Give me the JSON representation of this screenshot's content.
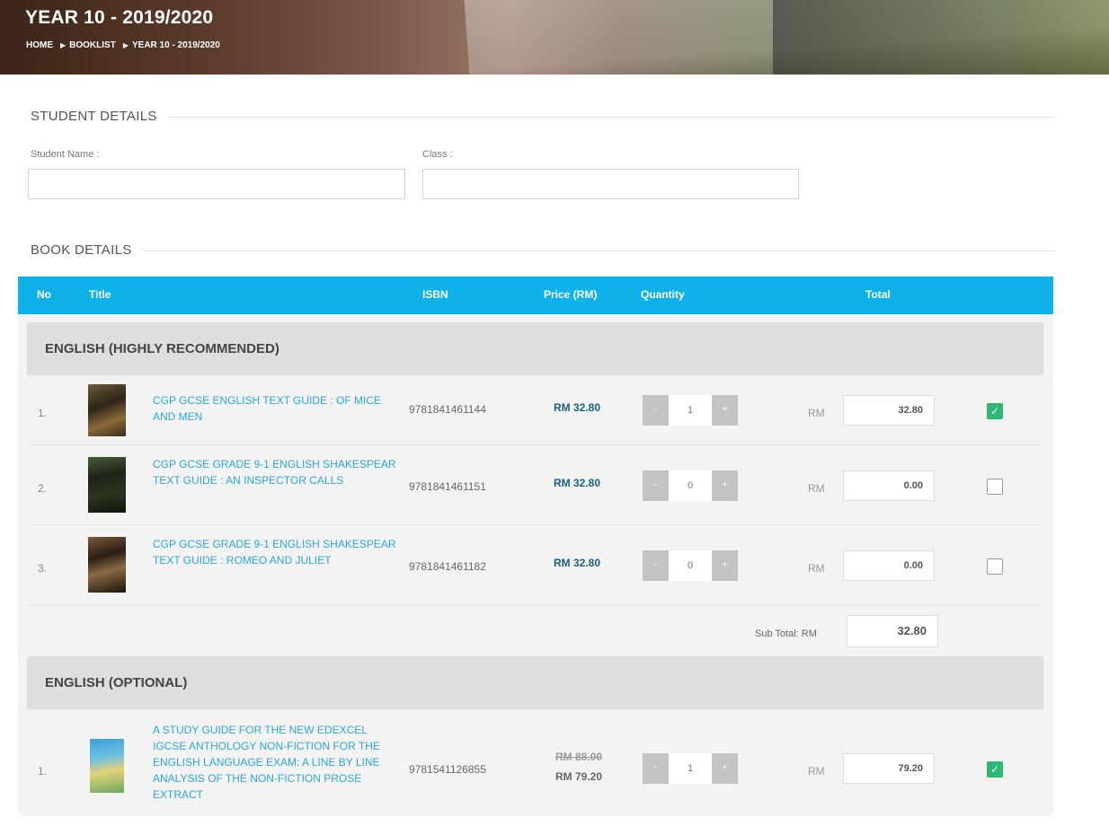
{
  "header": {
    "title": "YEAR 10 - 2019/2020",
    "breadcrumb": [
      "HOME",
      "BOOKLIST",
      "YEAR 10 - 2019/2020"
    ]
  },
  "student_details": {
    "section_title": "STUDENT DETAILS",
    "name_label": "Student Name :",
    "name_value": "",
    "class_label": "Class :",
    "class_value": ""
  },
  "book_details": {
    "section_title": "BOOK DETAILS",
    "columns": [
      "No",
      "Title",
      "ISBN",
      "Price (RM)",
      "Quantity",
      "Total"
    ],
    "categories": [
      {
        "name": "ENGLISH (HIGHLY RECOMMENDED)",
        "rows": [
          {
            "no": "1.",
            "title": "CGP GCSE ENGLISH TEXT GUIDE : OF MICE AND MEN",
            "isbn": "9781841461144",
            "price": "RM 32.80",
            "qty": "1",
            "currency": "RM",
            "total": "32.80",
            "checked": true
          },
          {
            "no": "2.",
            "title": "CGP GCSE GRADE 9-1 ENGLISH SHAKESPEAR TEXT GUIDE : AN INSPECTOR CALLS",
            "isbn": "9781841461151",
            "price": "RM 32.80",
            "qty": "0",
            "currency": "RM",
            "total": "0.00",
            "checked": false
          },
          {
            "no": "3.",
            "title": "CGP GCSE GRADE 9-1 ENGLISH SHAKESPEAR TEXT GUIDE : ROMEO AND JULIET",
            "isbn": "9781841461182",
            "price": "RM 32.80",
            "qty": "0",
            "currency": "RM",
            "total": "0.00",
            "checked": false
          }
        ],
        "subtotal_label": "Sub Total: RM",
        "subtotal": "32.80"
      },
      {
        "name": "ENGLISH (OPTIONAL)",
        "rows": [
          {
            "no": "1.",
            "title": "A STUDY GUIDE FOR THE NEW EDEXCEL IGCSE ANTHOLOGY NON-FICTION FOR THE ENGLISH LANGUAGE EXAM: A LINE BY LINE ANALYSIS OF THE NON-FICTION PROSE EXTRACT",
            "isbn": "9781541126855",
            "price_old": "RM 88.00",
            "price": "RM 79.20",
            "qty": "1",
            "currency": "RM",
            "total": "79.20",
            "checked": true
          }
        ]
      }
    ],
    "qty_minus": "-",
    "qty_plus": "+",
    "check_mark": "✓"
  },
  "colors": {
    "table_header": "#0fb2e8",
    "category_band": "#dedede",
    "row_bg": "#f3f3f3",
    "link": "#2aa7d6",
    "price": "#1d5f7d",
    "check_on": "#2db873",
    "qty_button": "#c3c3c3"
  },
  "icons": {
    "breadcrumb_separator": "triangle-right-icon",
    "checkbox_on": "checkmark-icon"
  }
}
